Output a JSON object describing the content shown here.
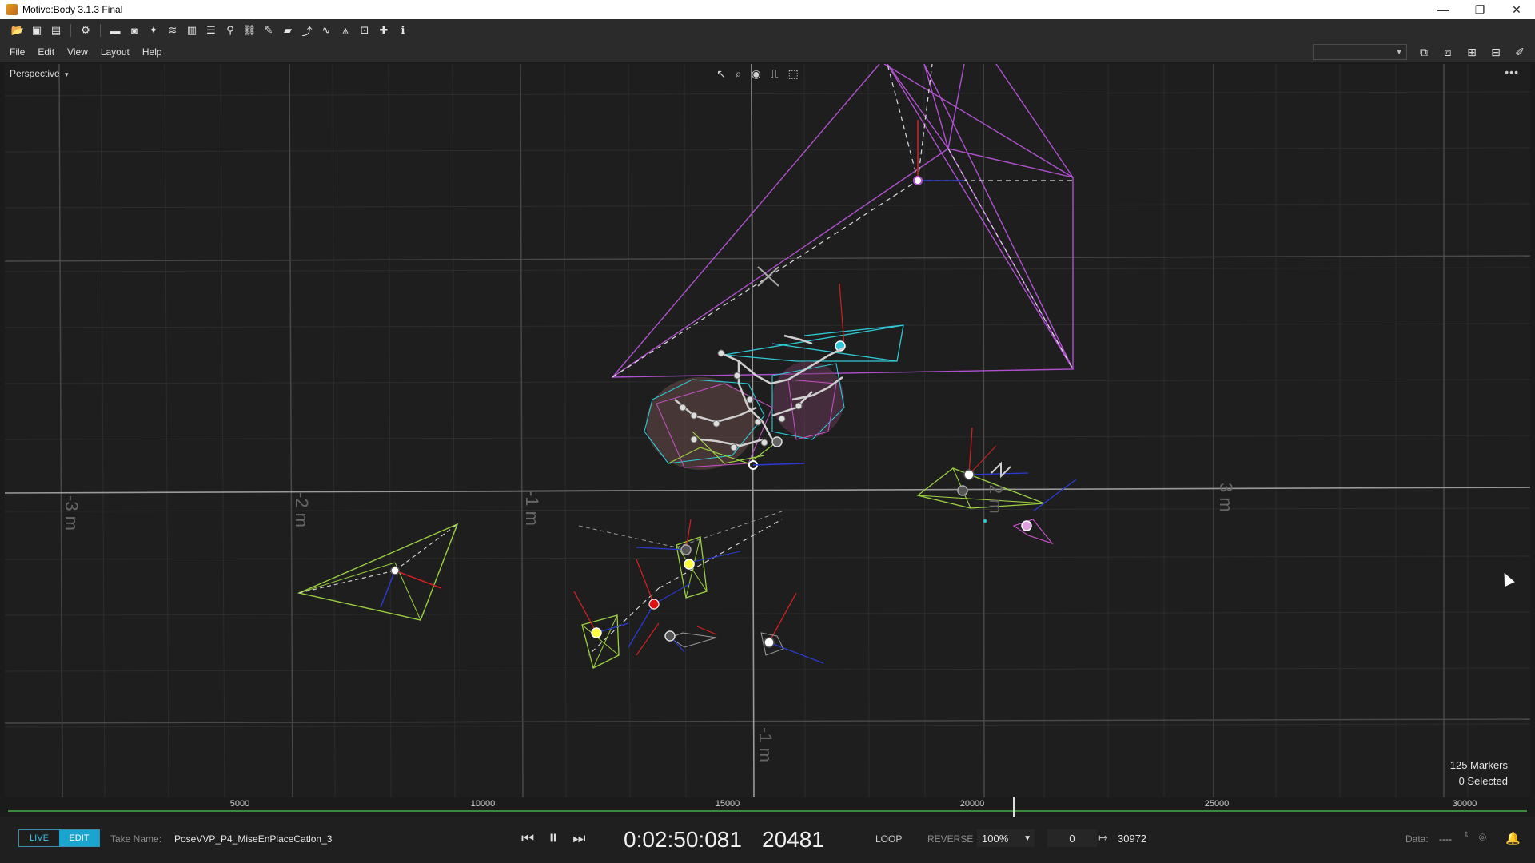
{
  "window": {
    "title": "Motive:Body 3.1.3 Final",
    "controls": {
      "minimize": "—",
      "maximize": "❐",
      "close": "✕"
    }
  },
  "toolbar": {
    "icons": [
      "open-icon",
      "save-icon",
      "save-as-icon",
      "settings-icon",
      "panel-icon",
      "camera-icon",
      "wand-icon",
      "database-icon",
      "trash-icon",
      "layers-icon",
      "skeleton-icon",
      "link-icon",
      "tool-icon",
      "marker-icon",
      "graph-icon",
      "curve-icon",
      "filter-icon",
      "label-icon",
      "star-icon",
      "info-icon"
    ]
  },
  "menu": {
    "items": [
      "File",
      "Edit",
      "View",
      "Layout",
      "Help"
    ]
  },
  "viewport": {
    "view_label": "Perspective",
    "axis_labels": [
      "-3 m",
      "-2 m",
      "-1 m",
      "2 m",
      "3 m",
      "-1 m"
    ],
    "marker_count": "125 Markers",
    "selected_count": "0 Selected"
  },
  "timeline": {
    "ticks": [
      "5000",
      "10000",
      "15000",
      "20000",
      "25000",
      "30000"
    ]
  },
  "bottom": {
    "mode_live": "LIVE",
    "mode_edit": "EDIT",
    "take_label": "Take Name:",
    "take_name": "PoseVVP_P4_MiseEnPlaceCatlon_3",
    "timecode": "0:02:50:081",
    "frame": "20481",
    "loop": "LOOP",
    "reverse": "REVERSE",
    "speed": "100%",
    "range_start": "0",
    "range_end": "30972",
    "data_label": "Data:",
    "data_value": "----"
  },
  "colors": {
    "accent": "#1aa4d0",
    "timeline_green": "#3b8a3b",
    "rigid_purple": "#b050d0",
    "rigid_green": "#9bd040",
    "rigid_cyan": "#30c8d8"
  }
}
